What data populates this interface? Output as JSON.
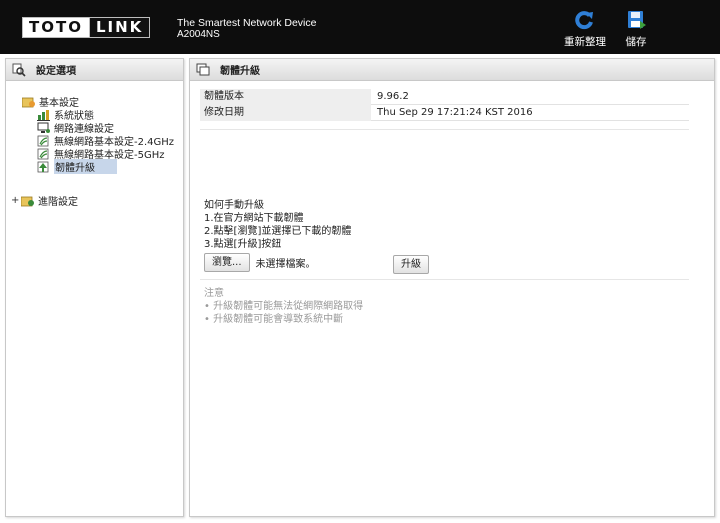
{
  "header": {
    "brand_left": "TOTO",
    "brand_right": "LINK",
    "tagline": "The Smartest Network Device",
    "model": "A2004NS",
    "refresh_label": "重新整理",
    "save_label": "儲存"
  },
  "sidebar": {
    "title": "設定選項",
    "basic": {
      "label": "基本設定",
      "items": [
        {
          "label": "系統狀態",
          "icon": "chart-icon"
        },
        {
          "label": "網路連線設定",
          "icon": "monitor-icon"
        },
        {
          "label": "無線網路基本設定-2.4GHz",
          "icon": "wireless-icon"
        },
        {
          "label": "無線網路基本設定-5GHz",
          "icon": "wireless-icon"
        },
        {
          "label": "韌體升級",
          "icon": "firmware-icon"
        }
      ]
    },
    "advanced": {
      "toggle": "+",
      "label": "進階設定"
    }
  },
  "main": {
    "title": "韌體升級",
    "info": [
      {
        "key": "韌體版本",
        "value": "9.96.2"
      },
      {
        "key": "修改日期",
        "value": "Thu Sep 29 17:21:24 KST 2016"
      }
    ],
    "howto": {
      "title": "如何手動升級",
      "steps": [
        "1.在官方網站下載韌體",
        "2.點擊[瀏覽]並選擇已下載的韌體",
        "3.點選[升級]按鈕"
      ]
    },
    "browse_label": "瀏覽...",
    "file_status": "未選擇檔案。",
    "upgrade_label": "升級",
    "notice": {
      "title": "注意",
      "items": [
        "• 升級韌體可能無法從網際網路取得",
        "• 升級韌體可能會導致系統中斷"
      ]
    }
  },
  "colors": {
    "header_bg": "#0d0d0d",
    "selected_bg": "#c7d6ea",
    "refresh_icon": "#2f7fd6",
    "save_icon": "#2f7fd6"
  }
}
